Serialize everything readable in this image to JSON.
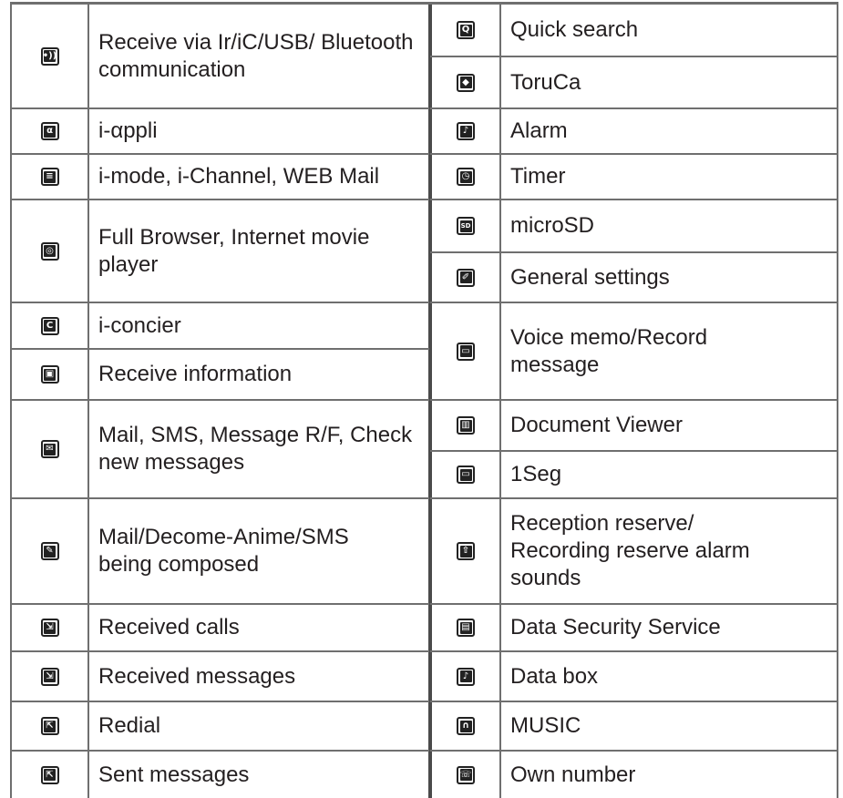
{
  "left_rows": [
    {
      "icon": "infrared-transfer-icon",
      "glyph": "•))",
      "label": "Receive via Ir/iC/USB/ Bluetooth communication"
    },
    {
      "icon": "i-appli-icon",
      "glyph": "α",
      "label": "i-αppli"
    },
    {
      "icon": "i-mode-icon",
      "glyph": "≡",
      "label": "i-mode, i-Channel, WEB Mail"
    },
    {
      "icon": "full-browser-icon",
      "glyph": "◎",
      "label": "Full Browser, Internet movie player"
    },
    {
      "icon": "i-concier-icon",
      "glyph": "C",
      "label": "i-concier"
    },
    {
      "icon": "receive-information-icon",
      "glyph": "▣",
      "label": "Receive information"
    },
    {
      "icon": "mail-icon",
      "glyph": "✉",
      "label": "Mail, SMS, Message R/F, Check new messages"
    },
    {
      "icon": "mail-compose-icon",
      "glyph": "✎",
      "label": "Mail/Decome-Anime/SMS being composed"
    },
    {
      "icon": "received-calls-icon",
      "glyph": "⇲",
      "label": "Received calls"
    },
    {
      "icon": "received-messages-icon",
      "glyph": "⇲",
      "label": "Received messages"
    },
    {
      "icon": "redial-icon",
      "glyph": "⇱",
      "label": "Redial"
    },
    {
      "icon": "sent-messages-icon",
      "glyph": "⇱",
      "label": "Sent messages"
    }
  ],
  "right_rows": [
    {
      "icon": "quick-search-icon",
      "glyph": "Q",
      "label": "Quick search"
    },
    {
      "icon": "toruca-icon",
      "glyph": "◆",
      "label": "ToruCa"
    },
    {
      "icon": "alarm-icon",
      "glyph": "♪",
      "label": "Alarm"
    },
    {
      "icon": "timer-icon",
      "glyph": "◷",
      "label": "Timer"
    },
    {
      "icon": "microsd-icon",
      "glyph": "SD",
      "label": "microSD"
    },
    {
      "icon": "general-settings-icon",
      "glyph": "✐",
      "label": "General settings"
    },
    {
      "icon": "voice-memo-icon",
      "glyph": "▭",
      "label": "Voice memo/Record message"
    },
    {
      "icon": "document-viewer-icon",
      "glyph": "▥",
      "label": "Document Viewer"
    },
    {
      "icon": "1seg-icon",
      "glyph": "▭",
      "label": "1Seg"
    },
    {
      "icon": "reception-reserve-icon",
      "glyph": "⇧",
      "label": "Reception reserve/ Recording reserve alarm sounds"
    },
    {
      "icon": "data-security-icon",
      "glyph": "▤",
      "label": "Data Security Service"
    },
    {
      "icon": "data-box-icon",
      "glyph": "♪",
      "label": "Data box"
    },
    {
      "icon": "music-icon",
      "glyph": "∩",
      "label": "MUSIC"
    },
    {
      "icon": "own-number-icon",
      "glyph": "☏",
      "label": "Own number"
    }
  ]
}
